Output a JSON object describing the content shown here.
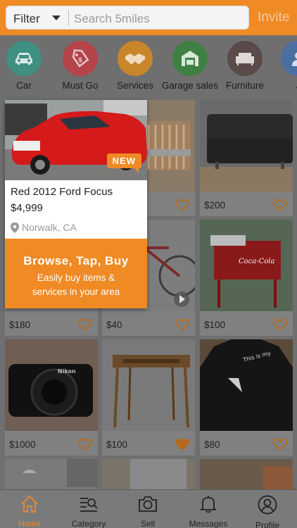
{
  "header": {
    "filter_label": "Filter",
    "search_placeholder": "Search 5miles",
    "invite_label": "Invite"
  },
  "categories": [
    {
      "label": "Car",
      "icon": "car-icon",
      "color": "#3f8f82"
    },
    {
      "label": "Must Go",
      "icon": "tag-icon",
      "color": "#b4434a"
    },
    {
      "label": "Services",
      "icon": "handshake-icon",
      "color": "#c9852a"
    },
    {
      "label": "Garage sales",
      "icon": "garage-icon",
      "color": "#3f8042"
    },
    {
      "label": "Furniture",
      "icon": "sofa-icon",
      "color": "#5a4a4a"
    },
    {
      "label": "J",
      "icon": "person-icon",
      "color": "#4a6ea0"
    }
  ],
  "featured": {
    "title": "Red 2012 Ford Focus",
    "price": "$4,999",
    "location": "Norwalk, CA",
    "badge": "NEW",
    "promo_title": "Browse, Tap, Buy",
    "promo_line1": "Easily buy items &",
    "promo_line2": "services in your area"
  },
  "listings": [
    {
      "price": "",
      "liked": false
    },
    {
      "price": "",
      "liked": false
    },
    {
      "price": "$200",
      "liked": false
    },
    {
      "price": "$180",
      "liked": false
    },
    {
      "price": "$40",
      "liked": false
    },
    {
      "price": "$100",
      "liked": false
    },
    {
      "price": "$1000",
      "liked": false
    },
    {
      "price": "$100",
      "liked": true
    },
    {
      "price": "$80",
      "liked": false
    }
  ],
  "nav": {
    "items": [
      {
        "label": "Home",
        "icon": "home-icon",
        "active": true
      },
      {
        "label": "Category",
        "icon": "category-icon",
        "active": false
      },
      {
        "label": "Sell",
        "icon": "camera-icon",
        "active": false
      },
      {
        "label": "Messages",
        "icon": "bell-icon",
        "active": false
      },
      {
        "label": "Profile",
        "icon": "user-icon",
        "active": false
      }
    ]
  },
  "colors": {
    "accent": "#f08a24",
    "overlay": "#6f6f6f"
  }
}
